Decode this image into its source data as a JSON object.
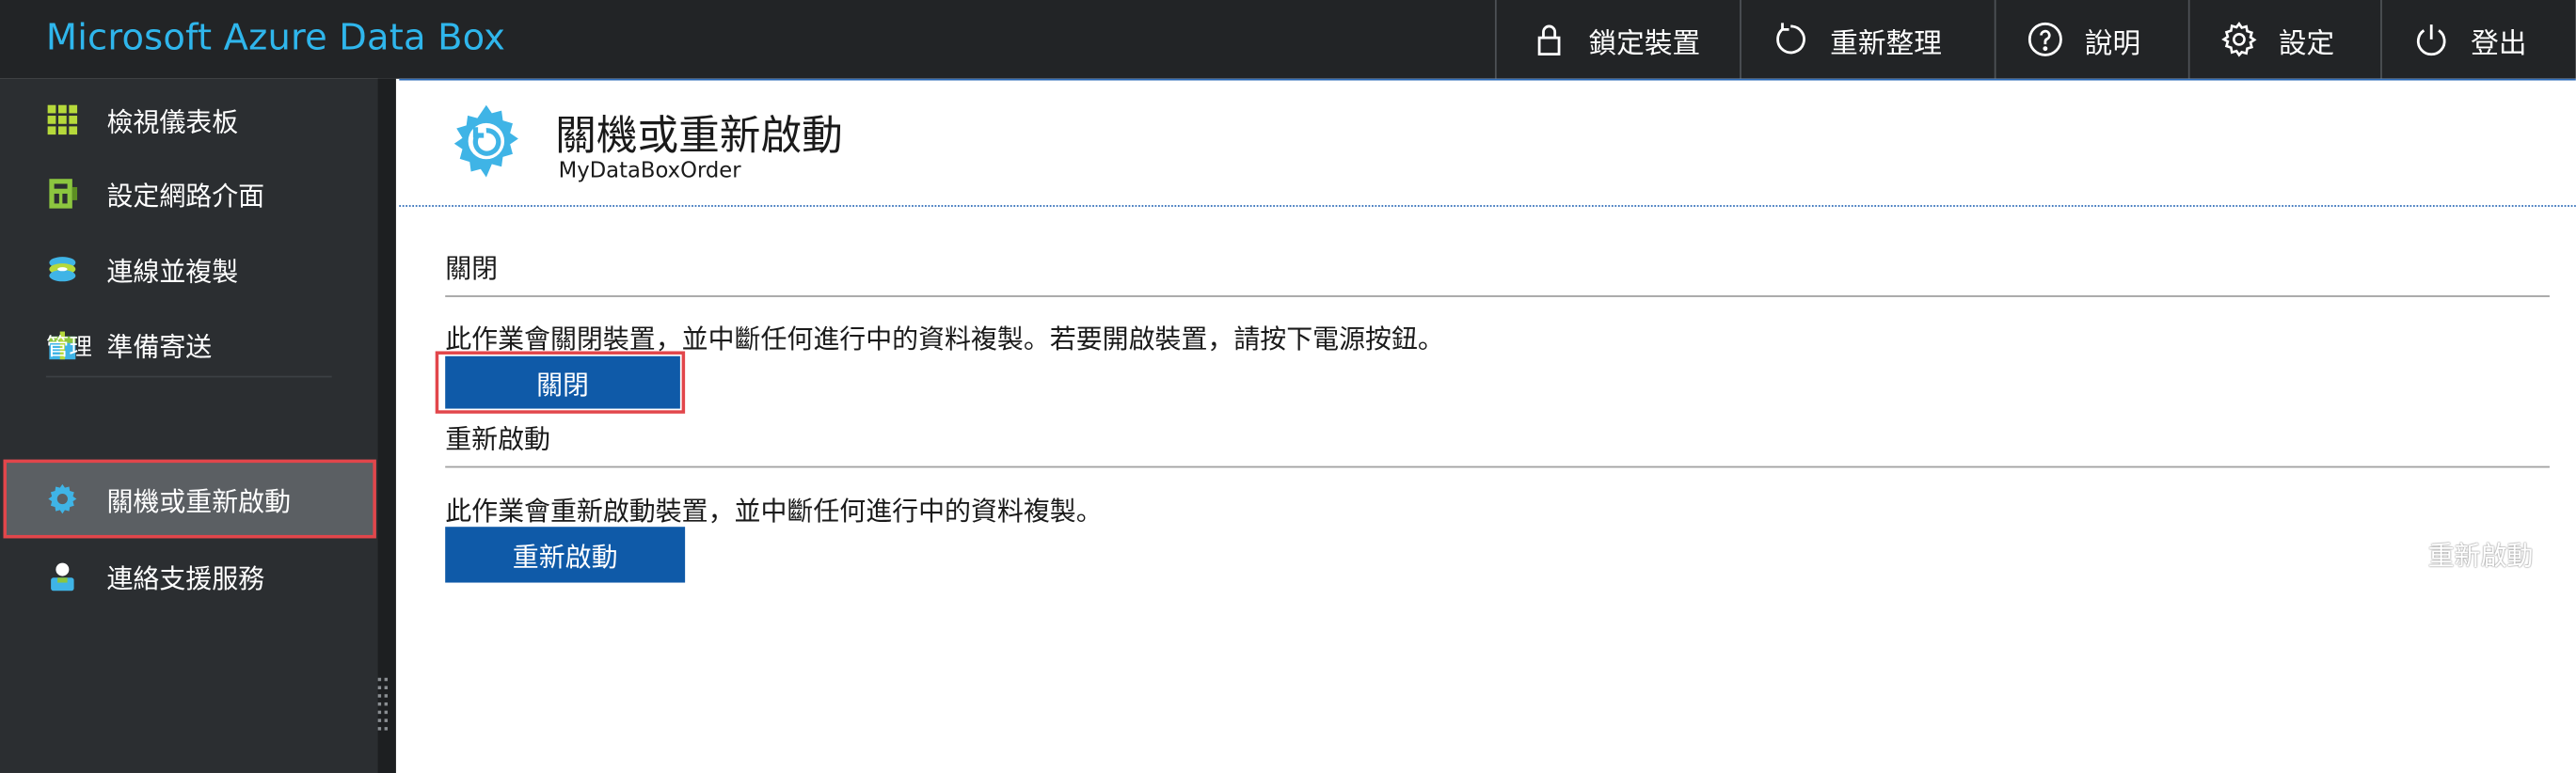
{
  "app": {
    "title": "Microsoft Azure Data Box"
  },
  "topbar": {
    "actions": [
      {
        "label": "鎖定裝置",
        "icon": "lock-icon"
      },
      {
        "label": "重新整理",
        "icon": "refresh-icon"
      },
      {
        "label": "說明",
        "icon": "help-icon"
      },
      {
        "label": "設定",
        "icon": "gear-icon"
      },
      {
        "label": "登出",
        "icon": "power-icon"
      }
    ]
  },
  "sidebar": {
    "items": [
      {
        "label": "檢視儀表板",
        "icon": "dashboard-grid-icon"
      },
      {
        "label": "設定網路介面",
        "icon": "network-icon"
      },
      {
        "label": "連線並複製",
        "icon": "copy-disk-icon"
      },
      {
        "label": "準備寄送",
        "icon": "package-icon"
      }
    ],
    "section_label": "管理",
    "manage_items": [
      {
        "label": "關機或重新啟動",
        "icon": "gear-icon",
        "active": true
      },
      {
        "label": "連絡支援服務",
        "icon": "support-person-icon"
      }
    ]
  },
  "page": {
    "title": "關機或重新啟動",
    "subtitle": "MyDataBoxOrder"
  },
  "shutdown": {
    "heading": "關閉",
    "description": "此作業會關閉裝置，並中斷任何進行中的資料複製。若要開啟裝置，請按下電源按鈕。",
    "button_label": "關閉"
  },
  "restart": {
    "heading": "重新啟動",
    "description": "此作業會重新啟動裝置，並中斷任何進行中的資料複製。",
    "button_label": "重新啟動",
    "ghost_label": "重新啟動"
  },
  "colors": {
    "topbar": "#222426",
    "sidebar": "#2b2e31",
    "accent": "#2fb6ec",
    "button": "#0f5aa8",
    "highlight": "#e2464b"
  }
}
